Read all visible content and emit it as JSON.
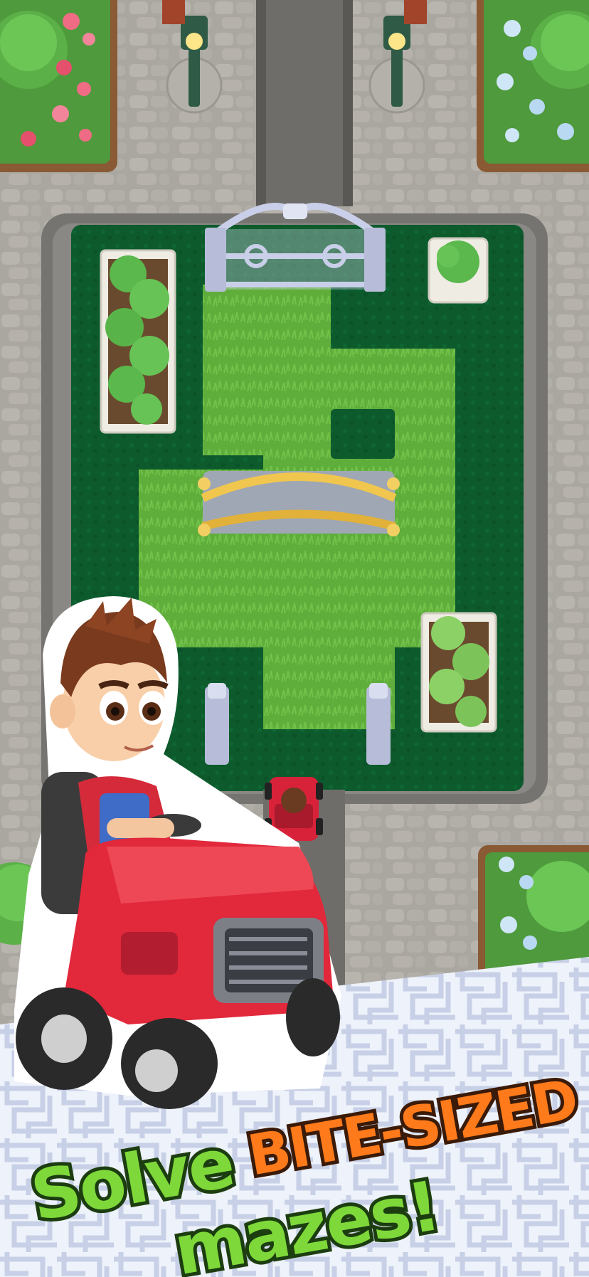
{
  "caption": {
    "line1_word1": "Solve",
    "line1_word2": "BITE-SIZED",
    "line2": "mazes!"
  },
  "colors": {
    "grass": "#5fae3b",
    "hedge": "#0d5b2d",
    "stone_path": "#a9a6a0",
    "gate": "#c9cfe8",
    "bridge_rail": "#e1b13a",
    "mower_red": "#e2283b",
    "caption_green": "#7ed83a",
    "caption_orange": "#ff6a1a"
  },
  "icons": {
    "character": "farmer-on-mower",
    "player_marker": "mower-topdown",
    "background_pattern": "maze-pattern"
  }
}
